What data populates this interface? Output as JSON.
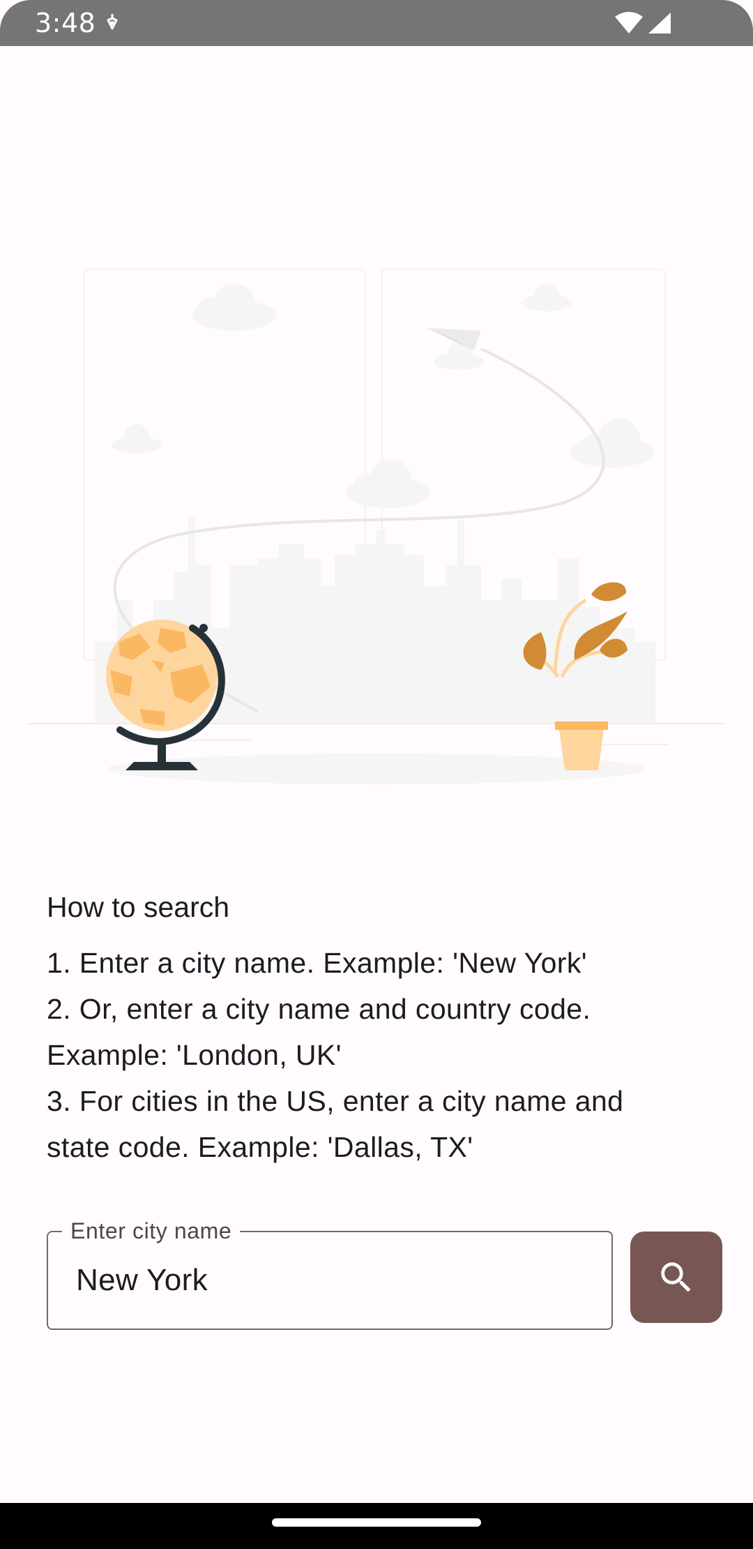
{
  "status_bar": {
    "time": "3:48",
    "icons": [
      "notification-icon",
      "wifi-icon",
      "cell-signal-icon"
    ]
  },
  "illustration": {
    "description_icons": [
      "globe-icon",
      "paper-plane-icon",
      "plant-icon",
      "city-skyline",
      "cloud-icon"
    ],
    "colors": {
      "globe_light": "#ffd59e",
      "globe_dark": "#fbb862",
      "stand": "#263238",
      "plant_leaf": "#d18b34",
      "pot": "#ffd59e",
      "skyline": "#f4f5f4"
    }
  },
  "instructions": {
    "title": "How to search",
    "lines": [
      "1. Enter a city name. Example: 'New York'",
      "2. Or, enter a city name and country code.",
      "Example: 'London, UK'",
      "3. For cities in the US, enter a city name and",
      "state code. Example: 'Dallas, TX'"
    ]
  },
  "search": {
    "label": "Enter city name",
    "value": "New York",
    "button_icon": "search-icon"
  },
  "colors": {
    "primary": "#775654",
    "outline": "#7b6563",
    "background": "#fffbfe"
  }
}
